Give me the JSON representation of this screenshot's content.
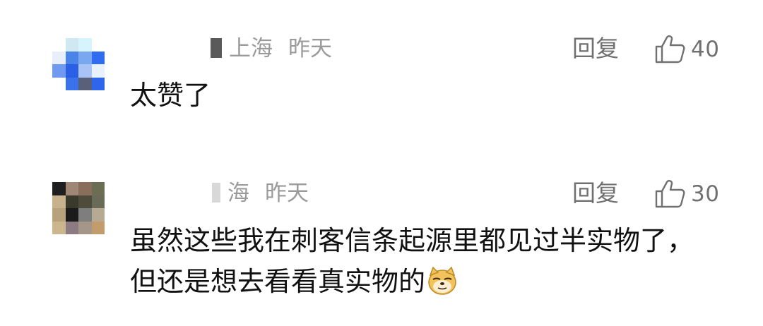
{
  "comments": [
    {
      "location": "上海",
      "time": "昨天",
      "reply_label": "回复",
      "like_count": "40",
      "text": "太赞了",
      "avatar_colors": [
        "#ffffff",
        "#cfe8f2",
        "#d6f4fb",
        "#ffffff",
        "#e8eefc",
        "#4a84e8",
        "#7aa8f0",
        "#2f6cf0",
        "#6f9aef",
        "#2a5fe6",
        "#a9c3f6",
        "#e9f0fe",
        "#ffffff",
        "#3a72ec",
        "#5a5f7a",
        "#2d66ea"
      ]
    },
    {
      "location": "海",
      "time": "昨天",
      "reply_label": "回复",
      "like_count": "30",
      "text": "虽然这些我在刺客信条起源里都见过半实物了，但还是想去看看真实物的",
      "emoji": "doge-emoji",
      "avatar_colors": [
        "#1f1f1f",
        "#a08674",
        "#8a6e5c",
        "#6b6e52",
        "#c8b28e",
        "#3a3a2c",
        "#4e4a3c",
        "#6a6a58",
        "#b7a27c",
        "#1b1b1b",
        "#7e7e7e",
        "#b6aa92",
        "#cbb68e",
        "#8c7b82",
        "#a49688",
        "#c29c6c"
      ]
    }
  ],
  "colors": {
    "meta_text": "#9a9a9a",
    "action_text": "#707070",
    "body_text": "#111111"
  },
  "icons": {
    "like": "thumbs-up-icon"
  }
}
